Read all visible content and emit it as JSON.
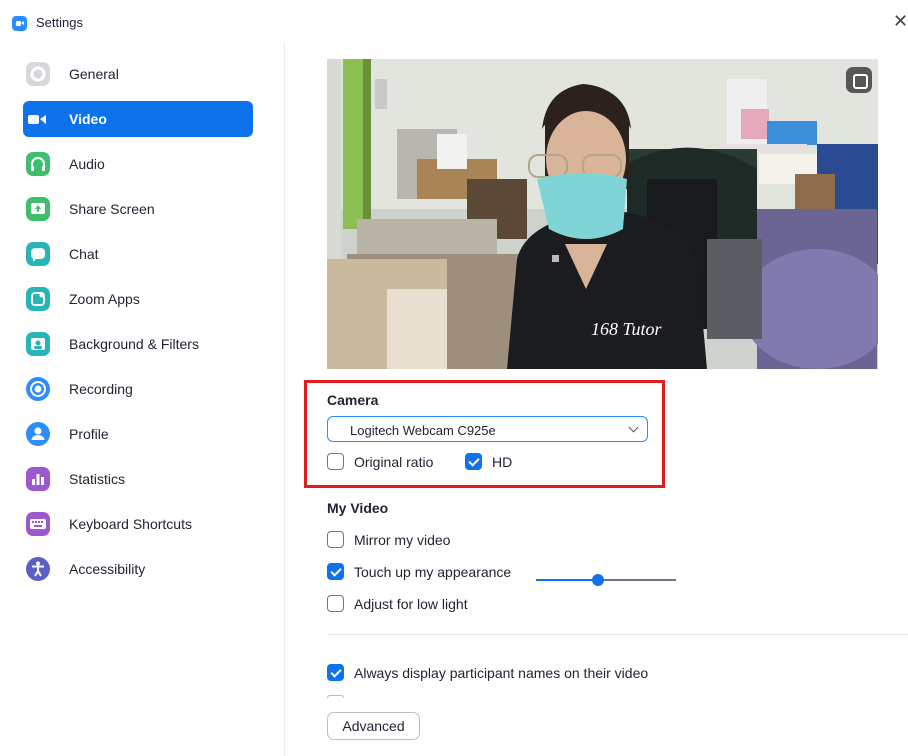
{
  "window": {
    "title": "Settings",
    "close_glyph": "✕"
  },
  "sidebar": {
    "items": [
      {
        "label": "General",
        "icon": "gear-icon",
        "color": "#d8d8dc",
        "active": false
      },
      {
        "label": "Video",
        "icon": "video-camera-icon",
        "color": "#0e72ed",
        "active": true
      },
      {
        "label": "Audio",
        "icon": "headphones-icon",
        "color": "#3fbf6e",
        "active": false
      },
      {
        "label": "Share Screen",
        "icon": "share-screen-icon",
        "color": "#3fbf6e",
        "active": false
      },
      {
        "label": "Chat",
        "icon": "chat-bubble-icon",
        "color": "#28b5b5",
        "active": false
      },
      {
        "label": "Zoom Apps",
        "icon": "zoom-apps-icon",
        "color": "#28b5b5",
        "active": false
      },
      {
        "label": "Background & Filters",
        "icon": "background-filters-icon",
        "color": "#28b5b5",
        "active": false
      },
      {
        "label": "Recording",
        "icon": "recording-icon",
        "color": "#2d8cff",
        "active": false
      },
      {
        "label": "Profile",
        "icon": "profile-icon",
        "color": "#2d8cff",
        "active": false
      },
      {
        "label": "Statistics",
        "icon": "statistics-icon",
        "color": "#9b59d0",
        "active": false
      },
      {
        "label": "Keyboard Shortcuts",
        "icon": "keyboard-icon",
        "color": "#9b59d0",
        "active": false
      },
      {
        "label": "Accessibility",
        "icon": "accessibility-icon",
        "color": "#5b5fc7",
        "active": false
      }
    ]
  },
  "video": {
    "camera": {
      "heading": "Camera",
      "selected": "Logitech Webcam C925e",
      "original_ratio": {
        "label": "Original ratio",
        "checked": false
      },
      "hd": {
        "label": "HD",
        "checked": true
      }
    },
    "my_video": {
      "heading": "My Video",
      "mirror": {
        "label": "Mirror my video",
        "checked": false
      },
      "touch_up": {
        "label": "Touch up my appearance",
        "checked": true,
        "level": 0.44
      },
      "low_light": {
        "label": "Adjust for low light",
        "checked": false
      }
    },
    "always_display_names": {
      "label": "Always display participant names on their video",
      "checked": true
    },
    "advanced_button": "Advanced",
    "preview_shirt_text": "168 Tutor"
  },
  "colors": {
    "accent": "#0e72ed",
    "highlight": "#e01e1e"
  }
}
